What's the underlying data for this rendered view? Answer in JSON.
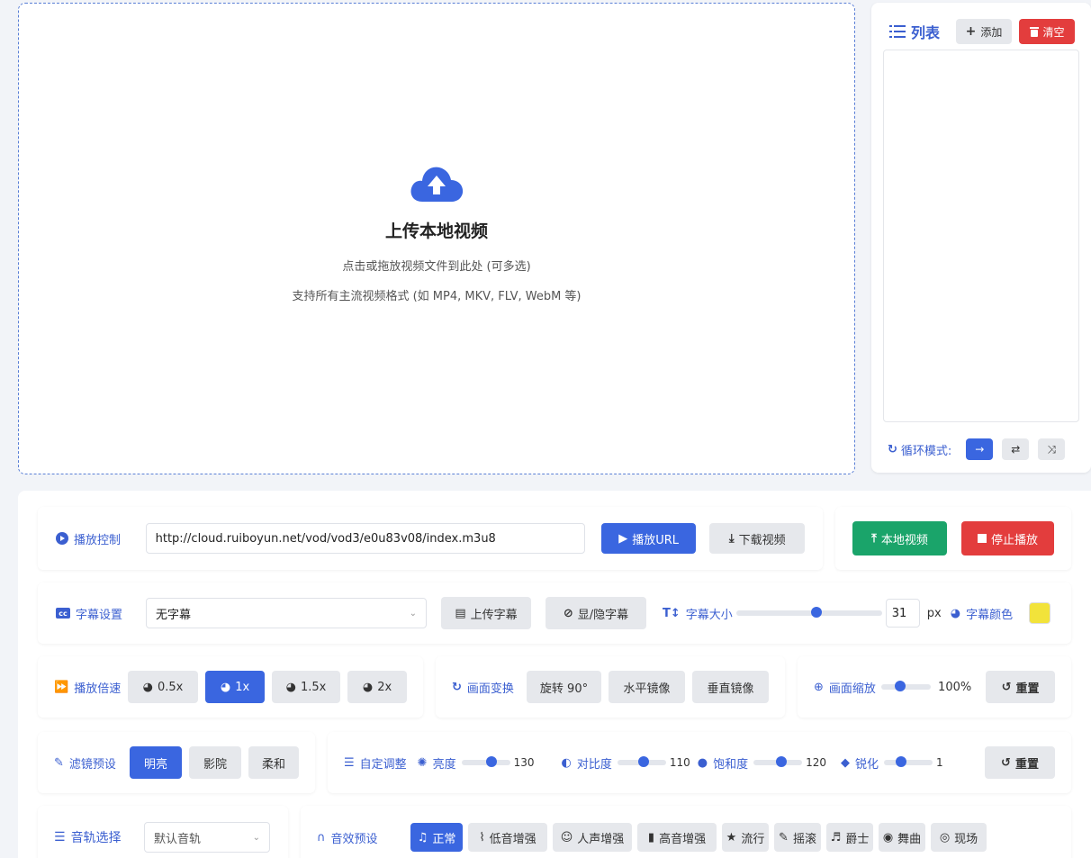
{
  "upload": {
    "title": "上传本地视频",
    "line1": "点击或拖放视频文件到此处 (可多选)",
    "line2": "支持所有主流视频格式 (如 MP4, MKV, FLV, WebM 等)"
  },
  "playlist": {
    "title": "列表",
    "add_label": "添加",
    "clear_label": "清空",
    "loop_label": "循环模式:"
  },
  "playback": {
    "label": "播放控制",
    "url": "http://cloud.ruiboyun.net/vod/vod3/e0u83v08/index.m3u8",
    "play_url_label": "播放URL",
    "download_label": "下载视频",
    "local_label": "本地视频",
    "stop_label": "停止播放"
  },
  "subtitle": {
    "label": "字幕设置",
    "selected": "无字幕",
    "upload_label": "上传字幕",
    "toggle_label": "显/隐字幕",
    "size_label": "字幕大小",
    "size_value": "31",
    "size_unit": "px",
    "size_level": 0.55,
    "color_label": "字幕颜色",
    "color_value": "#f2e33a"
  },
  "speed": {
    "label": "播放倍速",
    "options": [
      "0.5x",
      "1x",
      "1.5x",
      "2x"
    ],
    "active": "1x"
  },
  "transform": {
    "label": "画面变换",
    "rotate_label": "旋转 90°",
    "hflip_label": "水平镜像",
    "vflip_label": "垂直镜像"
  },
  "zoom": {
    "label": "画面缩放",
    "value": "100%",
    "level": 0.35,
    "reset_label": "重置"
  },
  "filter": {
    "label": "滤镜预设",
    "options": [
      "明亮",
      "影院",
      "柔和"
    ],
    "active": "明亮"
  },
  "adjust": {
    "label": "自定调整",
    "brightness_label": "亮度",
    "brightness_value": "130",
    "brightness_level": 0.65,
    "contrast_label": "对比度",
    "contrast_value": "110",
    "contrast_level": 0.55,
    "saturation_label": "饱和度",
    "saturation_value": "120",
    "saturation_level": 0.6,
    "sharpen_label": "锐化",
    "sharpen_value": "1",
    "sharpen_level": 0.3,
    "reset_label": "重置"
  },
  "audio": {
    "track_label": "音轨选择",
    "track_selected": "默认音轨",
    "effect_label": "音效预设",
    "effects": [
      "正常",
      "低音增强",
      "人声增强",
      "高音增强",
      "流行",
      "摇滚",
      "爵士",
      "舞曲",
      "现场"
    ],
    "active_effect": "正常"
  },
  "colors": {
    "accent": "#3a66e0",
    "danger": "#e33d3d",
    "success": "#1aa46a"
  }
}
